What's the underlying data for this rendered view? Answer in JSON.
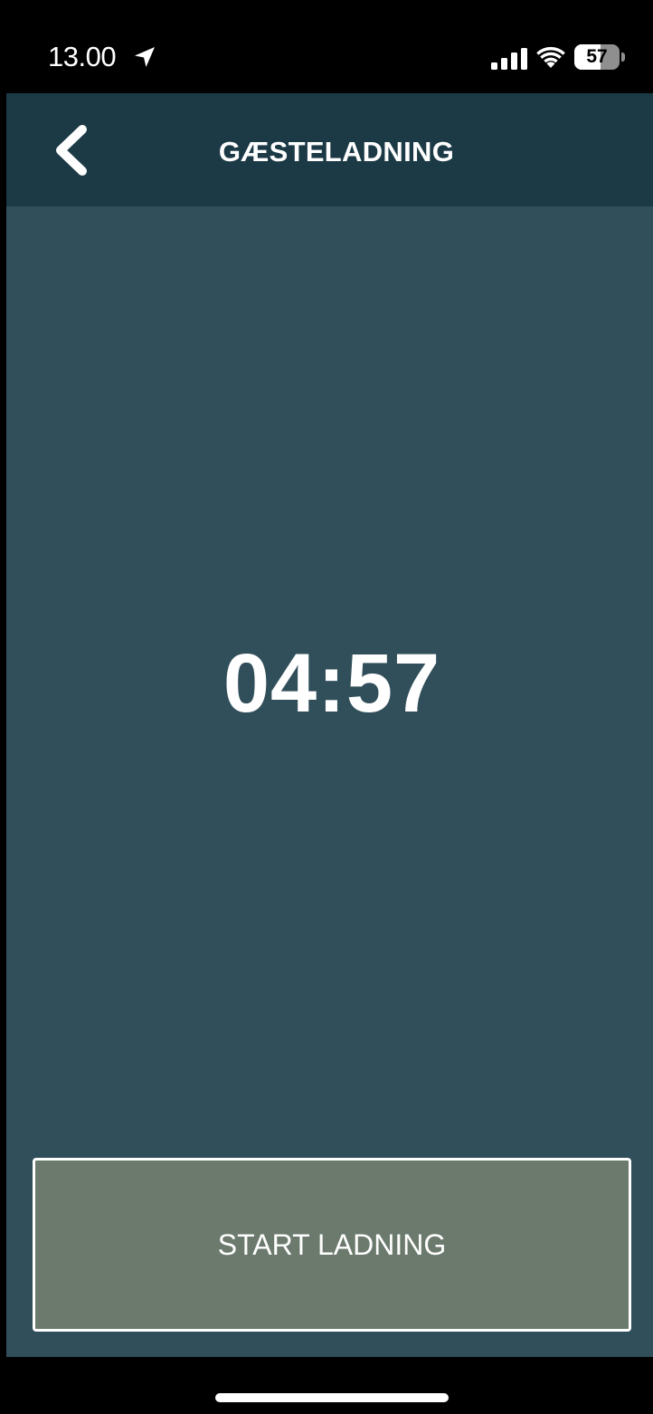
{
  "status_bar": {
    "time": "13.00",
    "battery_level": "57",
    "battery_fraction": 0.57
  },
  "nav": {
    "title": "GÆSTELADNING",
    "back_icon": "chevron-left-icon"
  },
  "timer": {
    "countdown": "04:57"
  },
  "actions": {
    "start_label": "START LADNING"
  },
  "colors": {
    "nav_background": "#1c3a46",
    "content_background": "#304f5a",
    "button_background": "#6b7a6c",
    "text": "#ffffff"
  }
}
